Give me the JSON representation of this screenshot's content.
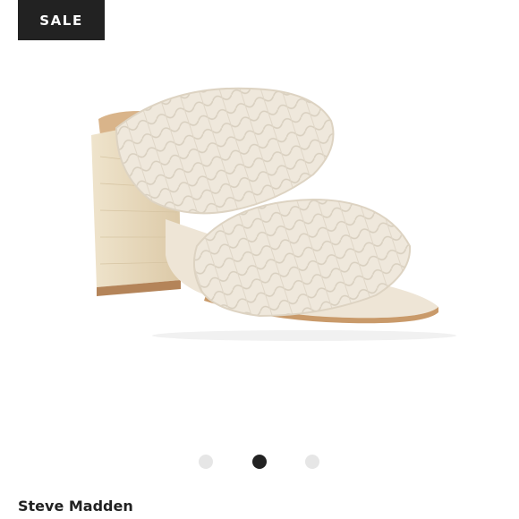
{
  "badge": {
    "label": "SALE"
  },
  "product": {
    "brand": "Steve Madden",
    "image_icon": "braided-heel-sandal-icon"
  },
  "carousel": {
    "total": 3,
    "active_index": 1
  },
  "colors": {
    "badge_bg": "#222222",
    "dot_active": "#222222",
    "dot_inactive": "#e6e6e6",
    "shoe": "#efe8dc",
    "heel": "#e6d8bc",
    "sole": "#c99a6a"
  }
}
